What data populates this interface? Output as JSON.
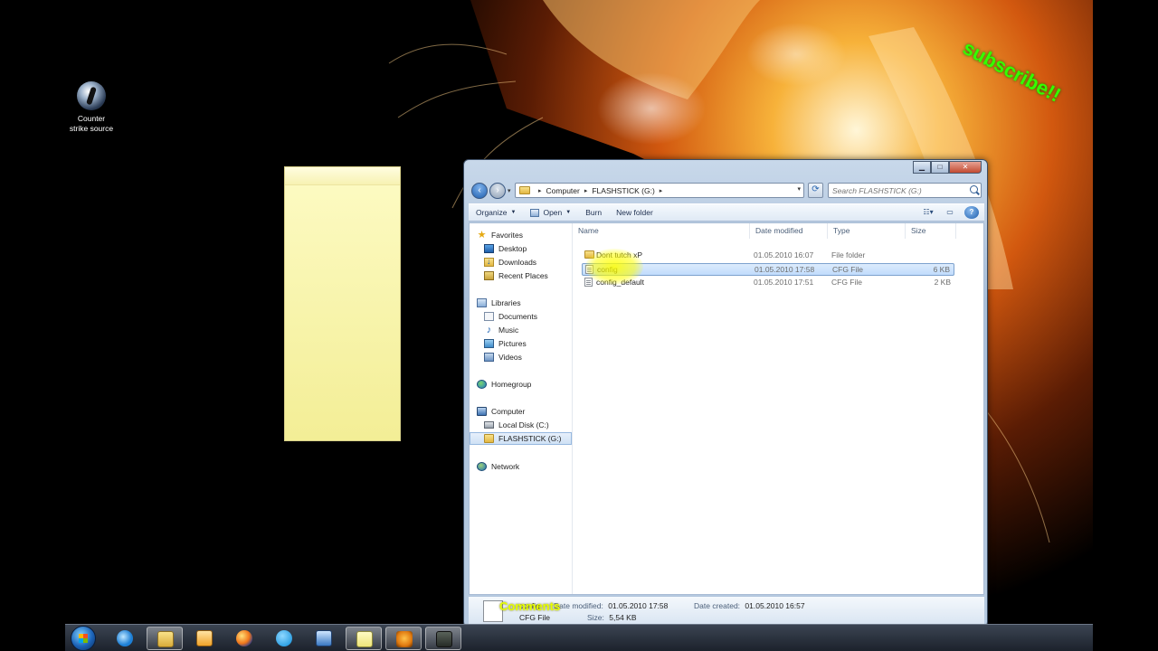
{
  "desktop": {
    "icon_label_line1": "Counter",
    "icon_label_line2": "strike source",
    "overlay_subscribe": "subscribe!!",
    "overlay_comments": "Comments"
  },
  "window": {
    "controls": {
      "minimize": "▁",
      "maximize": "□",
      "close": "✕"
    },
    "address": {
      "crumbs": [
        "Computer",
        "FLASHSTICK (G:)"
      ]
    },
    "search_placeholder": "Search FLASHSTICK (G:)",
    "toolbar": {
      "organize": "Organize",
      "open": "Open",
      "burn": "Burn",
      "new_folder": "New folder"
    },
    "nav": {
      "favorites": "Favorites",
      "desktop": "Desktop",
      "downloads": "Downloads",
      "recent_places": "Recent Places",
      "libraries": "Libraries",
      "documents": "Documents",
      "music": "Music",
      "pictures": "Pictures",
      "videos": "Videos",
      "homegroup": "Homegroup",
      "computer": "Computer",
      "local_disk": "Local Disk (C:)",
      "flashstick": "FLASHSTICK (G:)",
      "network": "Network"
    },
    "columns": {
      "name": "Name",
      "date": "Date modified",
      "type": "Type",
      "size": "Size"
    },
    "files": [
      {
        "name": "Dont tutch xP",
        "date": "01.05.2010 16:07",
        "type": "File folder",
        "size": ""
      },
      {
        "name": "config",
        "date": "01.05.2010 17:58",
        "type": "CFG File",
        "size": "6 KB"
      },
      {
        "name": "config_default",
        "date": "01.05.2010 17:51",
        "type": "CFG File",
        "size": "2 KB"
      }
    ],
    "details": {
      "name": "config",
      "date_modified_label": "Date modified:",
      "date_modified": "01.05.2010 17:58",
      "date_created_label": "Date created:",
      "date_created": "01.05.2010 16:57",
      "type": "CFG File",
      "size_label": "Size:",
      "size": "5,54 KB"
    }
  },
  "colors": {
    "selection": "#c1dcfc",
    "subscribe_green": "#34ff00",
    "highlight_yellow": "#ffff00"
  }
}
